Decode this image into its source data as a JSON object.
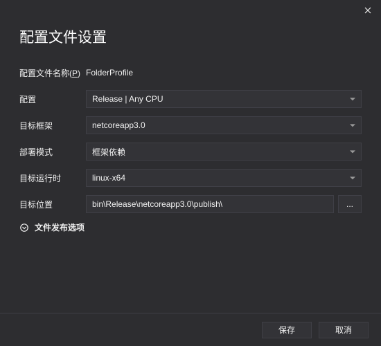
{
  "title": "配置文件设置",
  "fields": {
    "profileName": {
      "label": "配置文件名称(P)",
      "value": "FolderProfile"
    },
    "configuration": {
      "label": "配置",
      "value": "Release | Any CPU"
    },
    "targetFramework": {
      "label": "目标框架",
      "value": "netcoreapp3.0"
    },
    "deployMode": {
      "label": "部署模式",
      "value": "框架依赖"
    },
    "targetRuntime": {
      "label": "目标运行时",
      "value": "linux-x64"
    },
    "targetLocation": {
      "label": "目标位置",
      "value": "bin\\Release\\netcoreapp3.0\\publish\\"
    }
  },
  "expander": {
    "label": "文件发布选项"
  },
  "browseButton": "...",
  "buttons": {
    "save": "保存",
    "cancel": "取消"
  }
}
